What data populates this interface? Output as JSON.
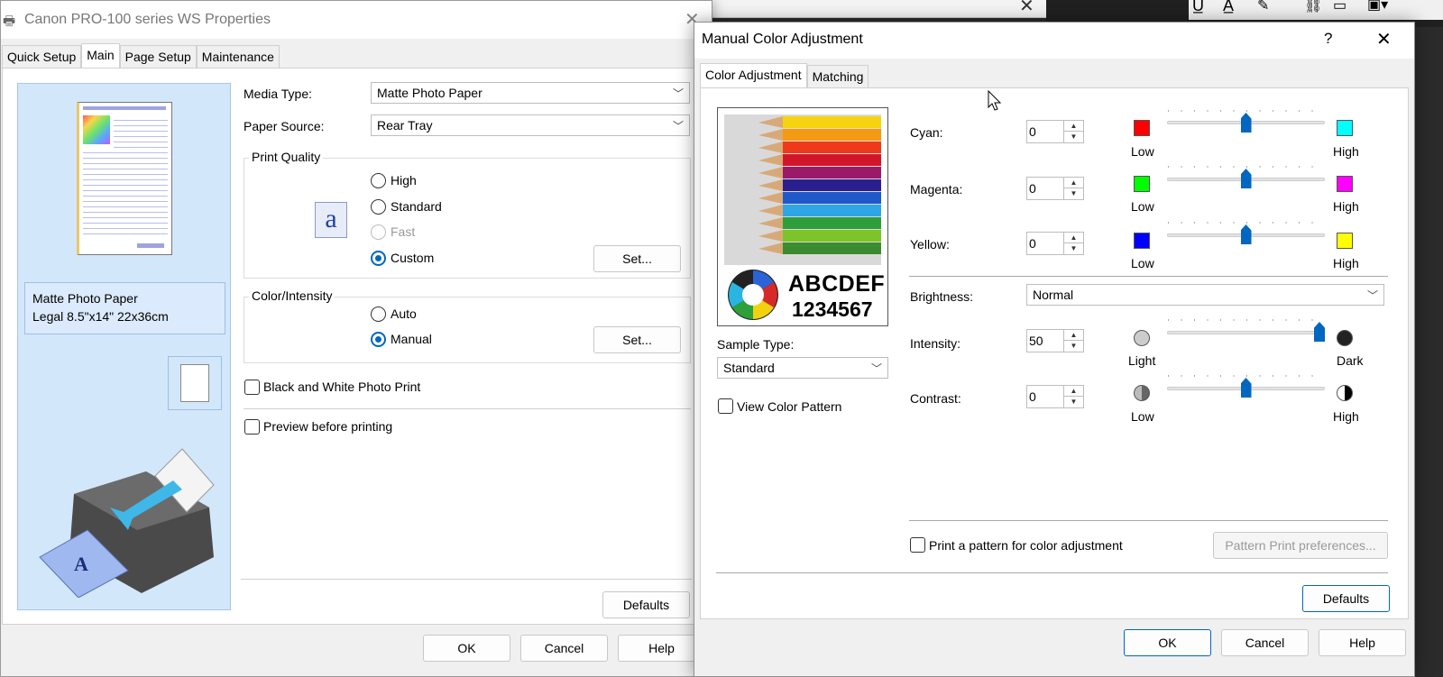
{
  "properties": {
    "title": "Canon PRO-100 series WS Properties",
    "tabs": [
      "Quick Setup",
      "Main",
      "Page Setup",
      "Maintenance"
    ],
    "active_tab": "Main",
    "media_type_label": "Media Type:",
    "media_type_value": "Matte Photo Paper",
    "paper_source_label": "Paper Source:",
    "paper_source_value": "Rear Tray",
    "print_quality": {
      "label": "Print Quality",
      "options": [
        "High",
        "Standard",
        "Fast",
        "Custom"
      ],
      "selected": "Custom",
      "set_button": "Set..."
    },
    "color_intensity": {
      "label": "Color/Intensity",
      "options": [
        "Auto",
        "Manual"
      ],
      "selected": "Manual",
      "set_button": "Set..."
    },
    "bw_photo_print": "Black and White Photo Print",
    "preview_before_printing": "Preview before printing",
    "paper_info_line1": "Matte Photo Paper",
    "paper_info_line2": "Legal 8.5\"x14\" 22x36cm",
    "defaults_button": "Defaults",
    "ok_button": "OK",
    "cancel_button": "Cancel",
    "help_button": "Help"
  },
  "dialog": {
    "title": "Manual Color Adjustment",
    "help_glyph": "?",
    "tabs": [
      "Color Adjustment",
      "Matching"
    ],
    "active_tab": "Color Adjustment",
    "sample_text_line1": "ABCDEF",
    "sample_text_line2": "1234567",
    "sample_type_label": "Sample Type:",
    "sample_type_value": "Standard",
    "view_color_pattern": "View Color Pattern",
    "cyan": {
      "label": "Cyan:",
      "value": "0",
      "low": "Low",
      "high": "High",
      "low_color": "#ff0000",
      "high_color": "#00ffff",
      "level": 0.5
    },
    "magenta": {
      "label": "Magenta:",
      "value": "0",
      "low": "Low",
      "high": "High",
      "low_color": "#00ff00",
      "high_color": "#ff00ff",
      "level": 0.5
    },
    "yellow": {
      "label": "Yellow:",
      "value": "0",
      "low": "Low",
      "high": "High",
      "low_color": "#0000ff",
      "high_color": "#ffff00",
      "level": 0.5
    },
    "brightness_label": "Brightness:",
    "brightness_value": "Normal",
    "intensity": {
      "label": "Intensity:",
      "value": "50",
      "low": "Light",
      "high": "Dark",
      "level": 1.0
    },
    "contrast": {
      "label": "Contrast:",
      "value": "0",
      "low": "Low",
      "high": "High",
      "level": 0.5
    },
    "print_pattern": "Print a pattern for color adjustment",
    "pattern_print_prefs": "Pattern Print preferences...",
    "defaults_button": "Defaults",
    "ok_button": "OK",
    "cancel_button": "Cancel",
    "help_button": "Help"
  },
  "colors": {
    "accent": "#0067c0",
    "preview_bg": "#d3e7fb"
  }
}
